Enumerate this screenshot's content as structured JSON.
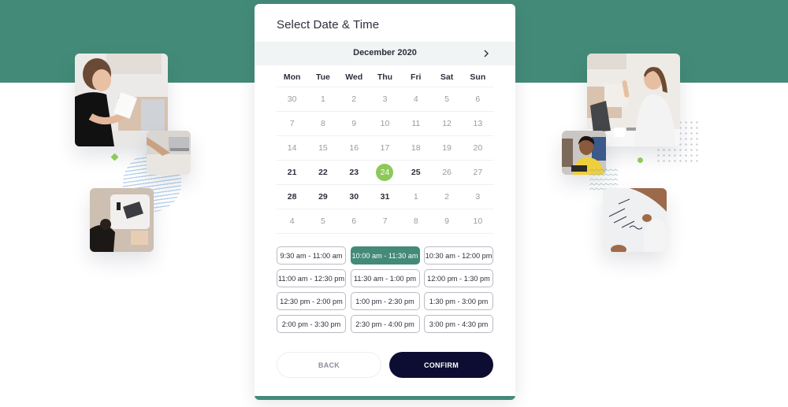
{
  "colors": {
    "brand_green": "#438b78",
    "selected_date": "#8dc85a",
    "confirm_button": "#0d0d33"
  },
  "card": {
    "title": "Select Date & Time",
    "month_label": "December 2020",
    "next_icon": "chevron-right-icon",
    "weekdays": [
      "Mon",
      "Tue",
      "Wed",
      "Thu",
      "Fri",
      "Sat",
      "Sun"
    ],
    "weeks": [
      [
        {
          "d": "30",
          "s": "muted"
        },
        {
          "d": "1",
          "s": "muted"
        },
        {
          "d": "2",
          "s": "muted"
        },
        {
          "d": "3",
          "s": "muted"
        },
        {
          "d": "4",
          "s": "muted"
        },
        {
          "d": "5",
          "s": "muted"
        },
        {
          "d": "6",
          "s": "muted"
        }
      ],
      [
        {
          "d": "7",
          "s": "muted"
        },
        {
          "d": "8",
          "s": "muted"
        },
        {
          "d": "9",
          "s": "muted"
        },
        {
          "d": "10",
          "s": "muted"
        },
        {
          "d": "11",
          "s": "muted"
        },
        {
          "d": "12",
          "s": "muted"
        },
        {
          "d": "13",
          "s": "muted"
        }
      ],
      [
        {
          "d": "14",
          "s": "muted"
        },
        {
          "d": "15",
          "s": "muted"
        },
        {
          "d": "16",
          "s": "muted"
        },
        {
          "d": "17",
          "s": "muted"
        },
        {
          "d": "18",
          "s": "muted"
        },
        {
          "d": "19",
          "s": "muted"
        },
        {
          "d": "20",
          "s": "muted"
        }
      ],
      [
        {
          "d": "21",
          "s": "active"
        },
        {
          "d": "22",
          "s": "active"
        },
        {
          "d": "23",
          "s": "active"
        },
        {
          "d": "24",
          "s": "selected"
        },
        {
          "d": "25",
          "s": "active"
        },
        {
          "d": "26",
          "s": "muted"
        },
        {
          "d": "27",
          "s": "muted"
        }
      ],
      [
        {
          "d": "28",
          "s": "active"
        },
        {
          "d": "29",
          "s": "active"
        },
        {
          "d": "30",
          "s": "active"
        },
        {
          "d": "31",
          "s": "active"
        },
        {
          "d": "1",
          "s": "muted"
        },
        {
          "d": "2",
          "s": "muted"
        },
        {
          "d": "3",
          "s": "muted"
        }
      ],
      [
        {
          "d": "4",
          "s": "muted"
        },
        {
          "d": "5",
          "s": "muted"
        },
        {
          "d": "6",
          "s": "muted"
        },
        {
          "d": "7",
          "s": "muted"
        },
        {
          "d": "8",
          "s": "muted"
        },
        {
          "d": "9",
          "s": "muted"
        },
        {
          "d": "10",
          "s": "muted"
        }
      ]
    ],
    "selected_date": "24",
    "time_slots": [
      {
        "label": "9:30 am - 11:00 am",
        "selected": false
      },
      {
        "label": "10:00 am - 11:30 am",
        "selected": true
      },
      {
        "label": "10:30 am - 12:00 pm",
        "selected": false
      },
      {
        "label": "11:00 am - 12:30 pm",
        "selected": false
      },
      {
        "label": "11:30 am - 1:00 pm",
        "selected": false
      },
      {
        "label": "12:00 pm - 1:30 pm",
        "selected": false
      },
      {
        "label": "12:30 pm - 2:00 pm",
        "selected": false
      },
      {
        "label": "1:00 pm - 2:30 pm",
        "selected": false
      },
      {
        "label": "1:30 pm - 3:00 pm",
        "selected": false
      },
      {
        "label": "2:00 pm - 3:30 pm",
        "selected": false
      },
      {
        "label": "2:30 pm - 4:00 pm",
        "selected": false
      },
      {
        "label": "3:00 pm - 4:30 pm",
        "selected": false
      }
    ],
    "back_label": "BACK",
    "confirm_label": "CONFIRM"
  },
  "decor": {
    "left_photos": [
      "woman-with-notebook-photo",
      "laptop-on-bed-photo",
      "women-working-on-floor-photo"
    ],
    "right_photos": [
      "woman-video-call-photo",
      "boy-yellow-shirt-photo",
      "writing-on-whiteboard-photo"
    ]
  }
}
